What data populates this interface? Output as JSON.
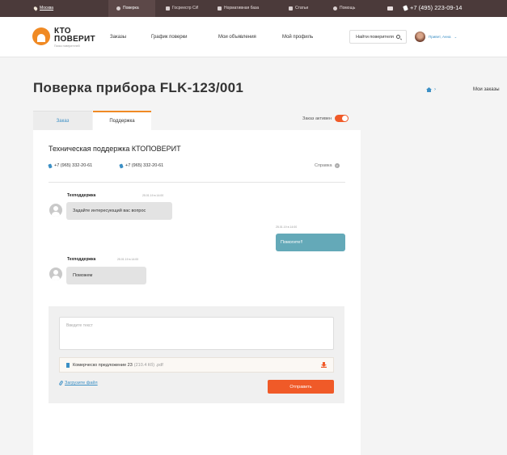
{
  "topbar": {
    "city": "Москва",
    "nav": [
      "Поверка",
      "Госреестр СИ",
      "Нормативная база",
      "Статьи",
      "Помощь"
    ],
    "phone": "+7 (495) 223-09-14"
  },
  "header": {
    "logo_line1": "КТО",
    "logo_line2": "ПОВЕРИТ",
    "logo_sub": "Поиск поверителей",
    "menu": [
      "Заказы",
      "График поверки",
      "Мои объявления",
      "Мой профиль"
    ],
    "find_button": "Найти поверителя",
    "user_greeting": "Привет, Анна"
  },
  "page": {
    "title": "Поверка прибора FLK-123/001",
    "breadcrumb_last": "Мои заказы"
  },
  "tabs": [
    "Заказ",
    "Поддержка"
  ],
  "order_active_label": "Заказ активен",
  "order_active": true,
  "support": {
    "title": "Техническая поддержка КТОПОВЕРИТ",
    "phones": [
      "+7 (965) 332-20-61",
      "+7 (965) 332-20-61"
    ],
    "help_label": "Справка"
  },
  "messages": [
    {
      "author": "Техподдержка",
      "time": "25.01.19 в 14:00",
      "text": "Задайте интересующий вас вопрос",
      "side": "in"
    },
    {
      "author": "",
      "time": "25.01.19 в 14:00",
      "text": "Помогите!!",
      "side": "out"
    },
    {
      "author": "Техподдержка",
      "time": "25.01.19 в 14:00",
      "text": "Поможем",
      "side": "in"
    }
  ],
  "compose": {
    "placeholder": "Введите текст",
    "file_name": "Комерческо предложение 23",
    "file_size": "(210.4 Кб) .pdf",
    "upload_label": "Загрузите файл",
    "send_label": "Отправить"
  },
  "colors": {
    "topbar": "#4b3a3a",
    "accent": "#f05a28",
    "link": "#3b8fc5",
    "outgoing_bubble": "#64a9b8"
  }
}
